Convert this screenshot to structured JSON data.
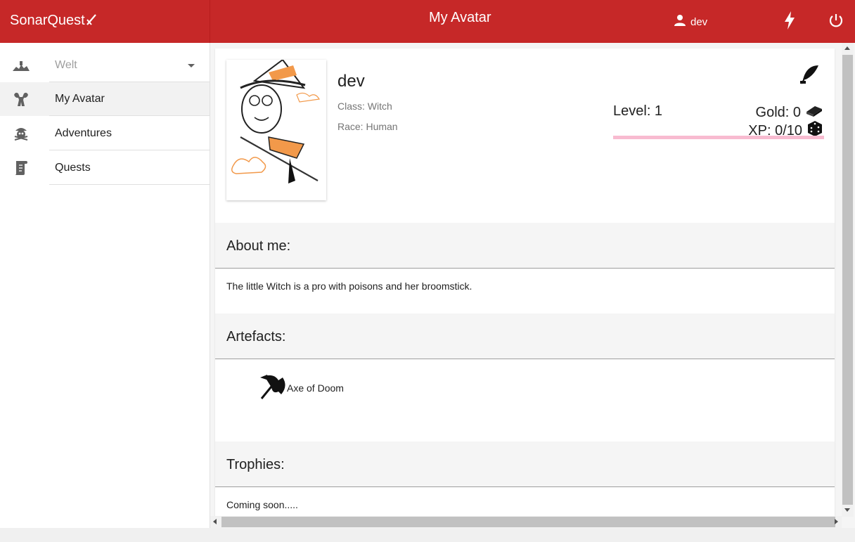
{
  "app": {
    "brand": "SonarQuest",
    "page_title": "My Avatar"
  },
  "header": {
    "username": "dev",
    "icons": [
      "person-icon",
      "lightning-bolt-icon",
      "power-icon"
    ]
  },
  "sidebar": {
    "world_label": "Welt",
    "items": [
      {
        "label": "My Avatar",
        "icon": "muscle-icon",
        "active": true
      },
      {
        "label": "Adventures",
        "icon": "pirate-skull-icon",
        "active": false
      },
      {
        "label": "Quests",
        "icon": "scroll-icon",
        "active": false
      }
    ]
  },
  "avatar": {
    "name": "dev",
    "class_text": "Class: Witch",
    "race_text": "Race: Human",
    "level_text": "Level: 1",
    "gold_text": "Gold: 0",
    "xp_text": "XP: 0/10",
    "xp_progress": 0.0
  },
  "sections": {
    "about_title": "About me:",
    "about_text": "The little Witch is a pro with poisons and her broomstick.",
    "artefacts_title": "Artefacts:",
    "artefact_name": "Axe of Doom",
    "trophies_title": "Trophies:",
    "trophies_text": "Coming soon....."
  },
  "colors": {
    "primary": "#c62828",
    "xp_bar": "#f8bbd0",
    "section_bg": "#f5f5f5"
  }
}
